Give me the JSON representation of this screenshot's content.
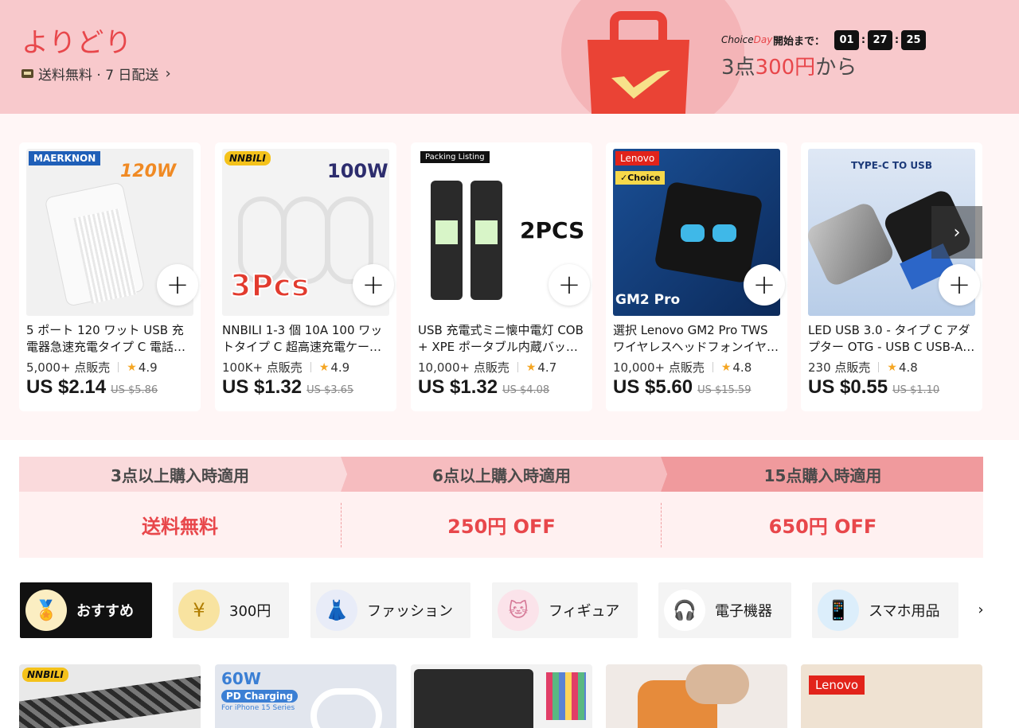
{
  "banner": {
    "title": "よりどり",
    "shipping": "送料無料 · 7 日配送",
    "brand_choice": "Choice",
    "brand_day": "Day",
    "countdown_label": "開始まで：",
    "timer": [
      "01",
      "27",
      "25"
    ],
    "offer_prefix": "3点",
    "offer_highlight": "300円",
    "offer_suffix": "から"
  },
  "products": [
    {
      "title": "5 ポート 120 ワット USB 充電器急速充電タイプ C 電話…",
      "sold": "5,000+ 点販売",
      "rating": "4.9",
      "price": "US $2.14",
      "was": "US $5.86",
      "badge": "MAERKNON",
      "tag": "120W"
    },
    {
      "title": "NNBILI 1-3 個 10A 100 ワットタイプ C 超高速充電ケー…",
      "sold": "100K+ 点販売",
      "rating": "4.9",
      "price": "US $1.32",
      "was": "US $3.65",
      "badge": "NNBILI",
      "tag": "100W"
    },
    {
      "title": "USB 充電式ミニ懐中電灯 COB + XPE ポータブル内蔵バッ…",
      "sold": "10,000+ 点販売",
      "rating": "4.7",
      "price": "US $1.32",
      "was": "US $4.08",
      "badge": "Packing Listing",
      "tag": "2PCS"
    },
    {
      "title": "選択 Lenovo GM2 Pro TWS ワイヤレスヘッドフォンイヤ…",
      "sold": "10,000+ 点販売",
      "rating": "4.8",
      "price": "US $5.60",
      "was": "US $15.59",
      "badge": "Lenovo",
      "tag": "GM2 Pro"
    },
    {
      "title": "LED USB 3.0 - タイプ C アダプター OTG - USB C USB-A…",
      "sold": "230 点販売",
      "rating": "4.8",
      "price": "US $0.55",
      "was": "US $1.10",
      "badge": "TYPE-C TO USB",
      "tag": ""
    }
  ],
  "tiers": [
    {
      "condition": "3点以上購入時適用",
      "benefit": "送料無料"
    },
    {
      "condition": "6点以上購入時適用",
      "benefit": "250円 OFF"
    },
    {
      "condition": "15点購入時適用",
      "benefit": "650円 OFF"
    }
  ],
  "categories": [
    {
      "label": "おすすめ",
      "icon": "medal-icon",
      "active": true
    },
    {
      "label": "300円",
      "icon": "coin-icon",
      "active": false
    },
    {
      "label": "ファッション",
      "icon": "dress-icon",
      "active": false
    },
    {
      "label": "フィギュア",
      "icon": "cat-figure-icon",
      "active": false
    },
    {
      "label": "電子機器",
      "icon": "earbuds-icon",
      "active": false
    },
    {
      "label": "スマホ用品",
      "icon": "phone-icon",
      "active": false
    }
  ],
  "grid_peek": [
    {
      "badge": "NNBILI"
    },
    {
      "badge": "60W",
      "sub": "PD Charging",
      "note": "For iPhone 15 Series"
    },
    {
      "badge": ""
    },
    {
      "badge": ""
    },
    {
      "badge": "Lenovo"
    }
  ],
  "colors": {
    "accent": "#e8474b",
    "banner_bg": "#f8c9cc",
    "tier_bg": "#fff1f1"
  }
}
